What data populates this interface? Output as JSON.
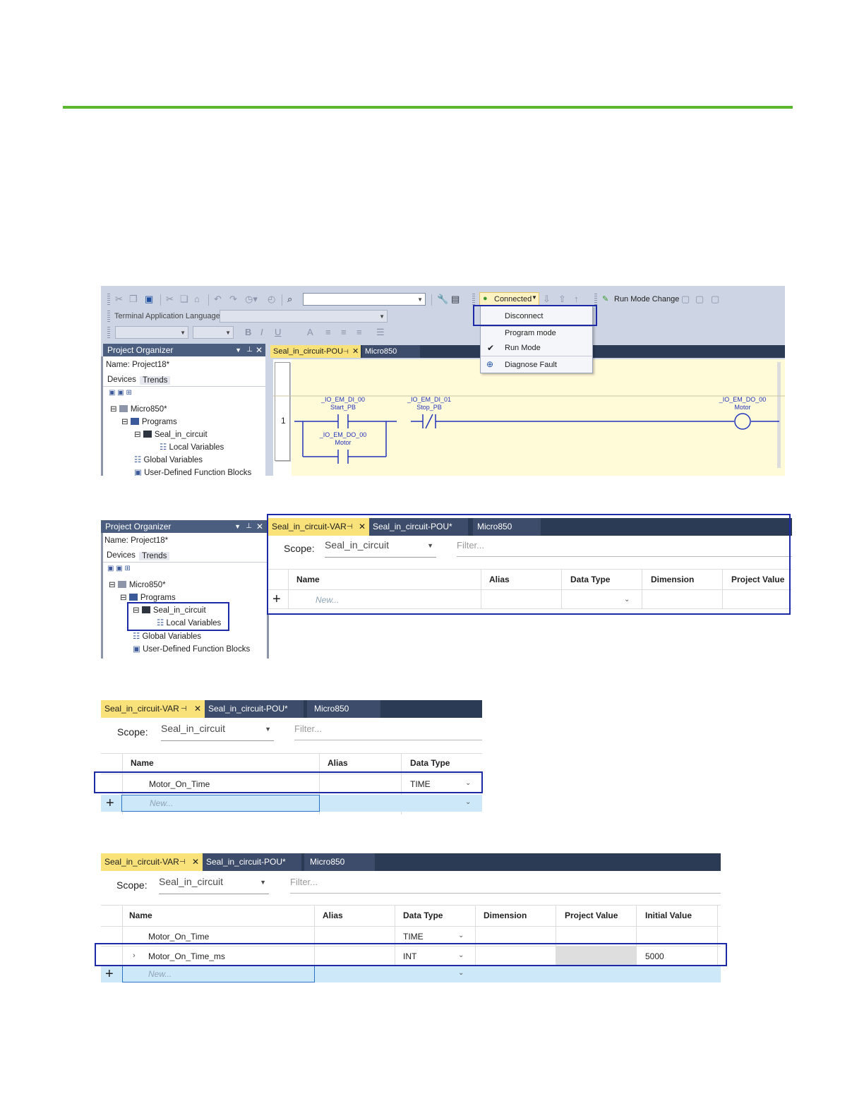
{
  "shot1": {
    "toolbar": {
      "terminal_label": "Terminal Application Language:",
      "connected_label": "Connected",
      "run_mode_change": "Run Mode Change"
    },
    "menu": {
      "items": [
        "Disconnect",
        "Program mode",
        "Run Mode",
        "Diagnose Fault"
      ],
      "checked_item": "Run Mode"
    },
    "organizer": {
      "title": "Project Organizer",
      "name_label": "Name:",
      "name_value": "Project18*",
      "tabs": [
        "Devices",
        "Trends"
      ],
      "tree": [
        "Micro850*",
        "Programs",
        "Seal_in_circuit",
        "Local Variables",
        "Global Variables",
        "User-Defined Function Blocks"
      ]
    },
    "editor_tabs": [
      "Seal_in_circuit-POU",
      "Micro850"
    ],
    "ladder": {
      "rung_number": "1",
      "contacts": [
        {
          "tag": "_IO_EM_DI_00",
          "alias": "Start_PB"
        },
        {
          "tag": "_IO_EM_DI_01",
          "alias": "Stop_PB"
        },
        {
          "tag": "_IO_EM_DO_00",
          "alias": "Motor"
        }
      ],
      "coil": {
        "tag": "_IO_EM_DO_00",
        "alias": "Motor"
      }
    }
  },
  "shot2": {
    "organizer": {
      "title": "Project Organizer",
      "name_label": "Name:",
      "name_value": "Project18*",
      "tabs": [
        "Devices",
        "Trends"
      ],
      "tree": [
        "Micro850*",
        "Programs",
        "Seal_in_circuit",
        "Local Variables",
        "Global Variables",
        "User-Defined Function Blocks"
      ]
    },
    "tabs": [
      "Seal_in_circuit-VAR",
      "Seal_in_circuit-POU*",
      "Micro850"
    ],
    "scope_label": "Scope:",
    "scope_value": "Seal_in_circuit",
    "filter_placeholder": "Filter...",
    "columns": [
      "Name",
      "Alias",
      "Data Type",
      "Dimension",
      "Project Value"
    ],
    "new_row": "New..."
  },
  "shot3": {
    "tabs": [
      "Seal_in_circuit-VAR",
      "Seal_in_circuit-POU*",
      "Micro850"
    ],
    "scope_label": "Scope:",
    "scope_value": "Seal_in_circuit",
    "filter_placeholder": "Filter...",
    "columns": [
      "Name",
      "Alias",
      "Data Type"
    ],
    "rows": [
      {
        "name": "Motor_On_Time",
        "alias": "",
        "type": "TIME"
      }
    ],
    "new_row": "New..."
  },
  "shot4": {
    "tabs": [
      "Seal_in_circuit-VAR",
      "Seal_in_circuit-POU*",
      "Micro850"
    ],
    "scope_label": "Scope:",
    "scope_value": "Seal_in_circuit",
    "filter_placeholder": "Filter...",
    "columns": [
      "Name",
      "Alias",
      "Data Type",
      "Dimension",
      "Project Value",
      "Initial Value"
    ],
    "rows": [
      {
        "name": "Motor_On_Time",
        "alias": "",
        "type": "TIME",
        "dimension": "",
        "project_value": "",
        "initial_value": ""
      },
      {
        "name": "Motor_On_Time_ms",
        "alias": "",
        "type": "INT",
        "dimension": "",
        "project_value": "",
        "initial_value": "5000"
      }
    ],
    "new_row": "New..."
  },
  "colors": {
    "accent_green": "#5cb82e",
    "highlight_box": "#1c2aa8",
    "active_tab": "#f9e27a",
    "tab_bar": "#2b3a55"
  }
}
